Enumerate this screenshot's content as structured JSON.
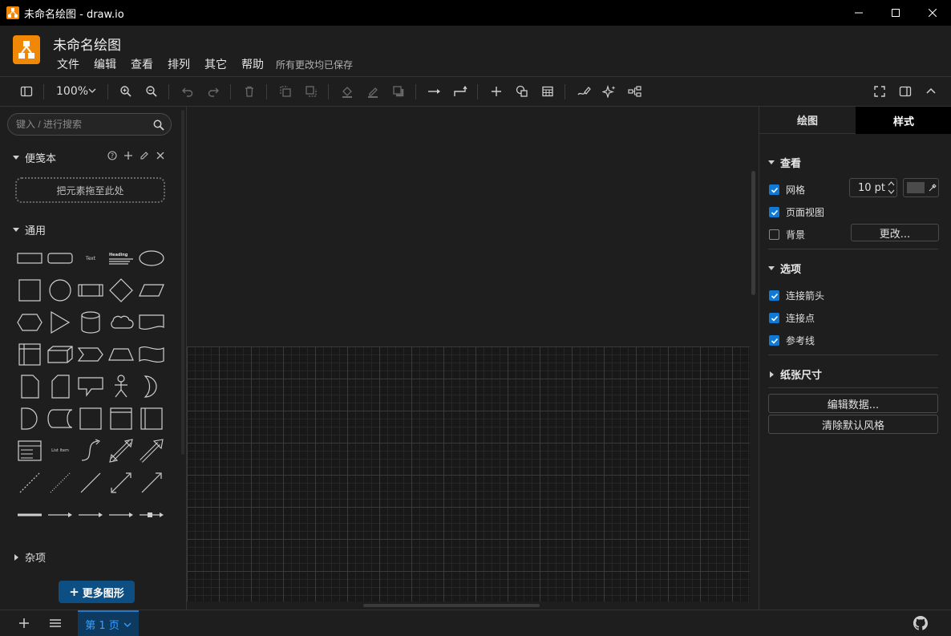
{
  "window": {
    "title": "未命名绘图 - draw.io",
    "minimize": "minimize",
    "maximize": "maximize",
    "close": "close"
  },
  "header": {
    "doc_title": "未命名绘图",
    "menu": [
      "文件",
      "编辑",
      "查看",
      "排列",
      "其它",
      "帮助"
    ],
    "save_status": "所有更改均已保存"
  },
  "toolbar": {
    "zoom": "100%",
    "icons": [
      "sidebar-toggle",
      "zoom-in",
      "zoom-out",
      "undo",
      "redo",
      "delete",
      "to-front",
      "to-back",
      "fill-color",
      "line-color",
      "shadow",
      "connection",
      "waypoints",
      "insert",
      "shapes",
      "table",
      "freehand",
      "ai-generate",
      "layout",
      "fullscreen",
      "format-panel",
      "collapse"
    ]
  },
  "sidebar": {
    "search_placeholder": "键入 / 进行搜索",
    "scratchpad_title": "便笺本",
    "dropzone": "把元素拖至此处",
    "general_title": "通用",
    "misc_title": "杂项",
    "more_shapes": "更多图形",
    "shape_text_label": "Text",
    "shape_heading_label": "Heading",
    "shape_list_label": "List Item"
  },
  "right_panel": {
    "tabs": [
      "绘图",
      "样式"
    ],
    "active_tab": "样式",
    "view_section": "查看",
    "grid_label": "网格",
    "grid_checked": true,
    "grid_size": "10 pt",
    "grid_color": "#4b4b4b",
    "pageview_label": "页面视图",
    "pageview_checked": true,
    "background_label": "背景",
    "background_checked": false,
    "change_button": "更改...",
    "options_section": "选项",
    "connection_arrows": "连接箭头",
    "connection_points": "连接点",
    "guides": "参考线",
    "paper_size_section": "纸张尺寸",
    "edit_data_button": "编辑数据...",
    "clear_style_button": "清除默认风格"
  },
  "bottom": {
    "page_tab": "第 1 页"
  },
  "colors": {
    "accent": "#0e7ad6",
    "brand": "#f08705",
    "more_shapes_bg": "#0d4f83"
  }
}
